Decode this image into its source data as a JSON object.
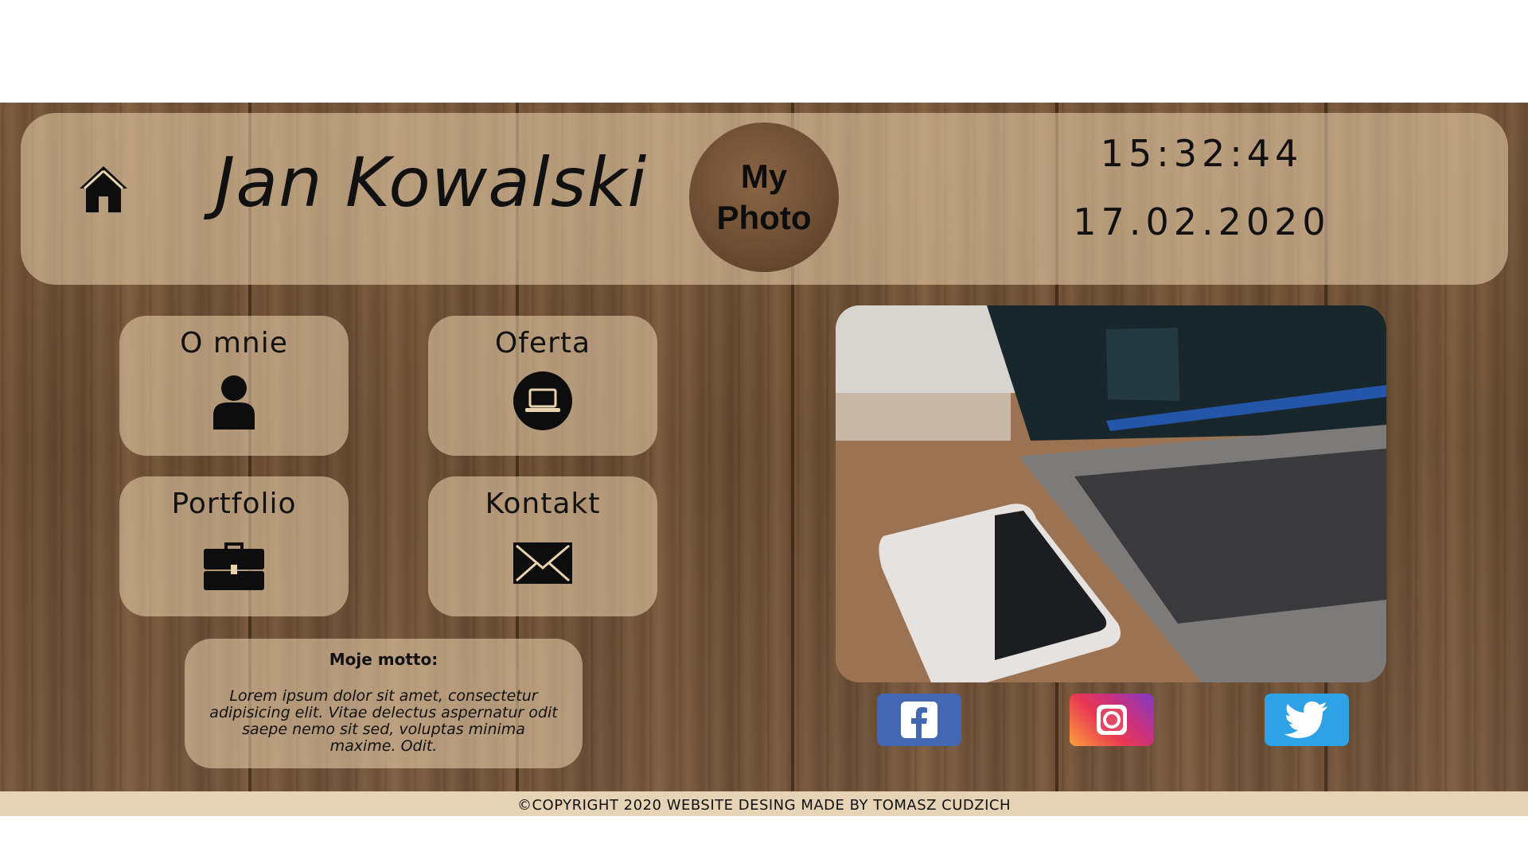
{
  "header": {
    "name": "Jan Kowalski",
    "photo_label": "My Photo",
    "time": "15:32:44",
    "date": "17.02.2020",
    "home_icon": "home-icon"
  },
  "nav": {
    "items": [
      {
        "label": "O mnie",
        "icon": "user-icon"
      },
      {
        "label": "Oferta",
        "icon": "laptop-icon"
      },
      {
        "label": "Portfolio",
        "icon": "briefcase-icon"
      },
      {
        "label": "Kontakt",
        "icon": "envelope-icon"
      }
    ]
  },
  "motto": {
    "title": "Moje motto:",
    "text": "Lorem ipsum dolor sit amet, consectetur adipisicing elit. Vitae delectus aspernatur odit saepe nemo sit sed, voluptas minima maxime. Odit."
  },
  "social": {
    "items": [
      {
        "name": "facebook",
        "color": "#4367b2"
      },
      {
        "name": "instagram",
        "color": "#e1306c"
      },
      {
        "name": "twitter",
        "color": "#2ea2e4"
      }
    ]
  },
  "footer": {
    "text": "©COPYRIGHT 2020 WEBSITE DESING MADE BY TOMASZ CUDZICH"
  }
}
